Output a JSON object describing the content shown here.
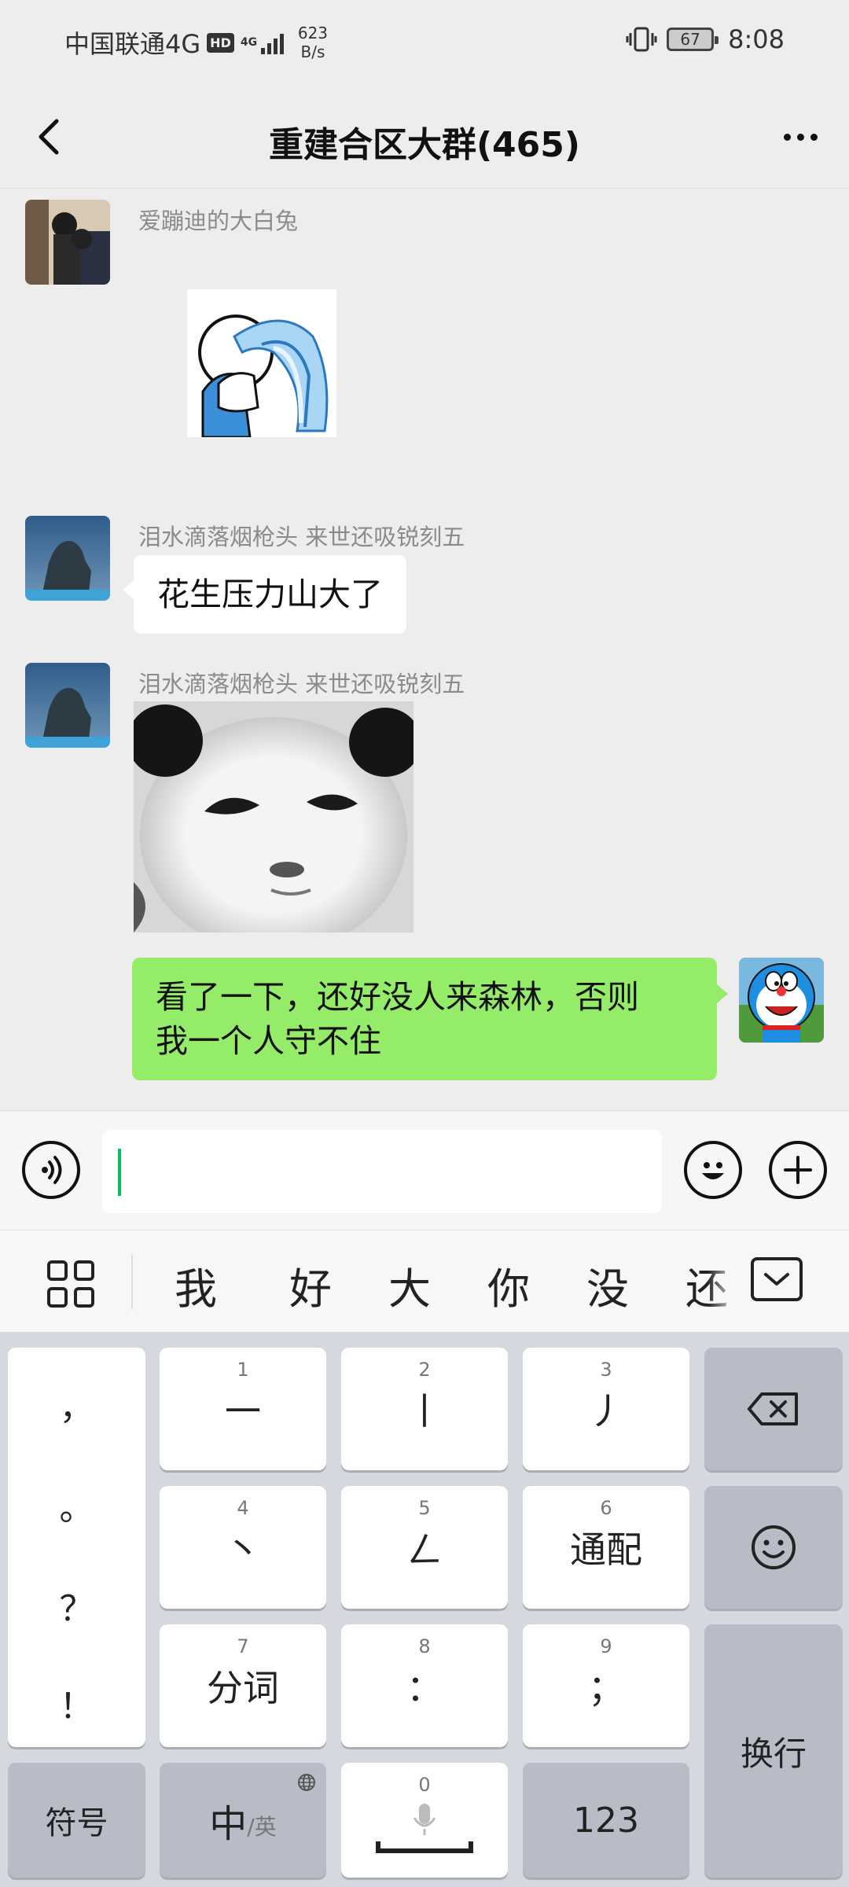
{
  "status_bar": {
    "carrier": "中国联通4G",
    "hd": "HD",
    "network_type": "4G",
    "speed_value": "623",
    "speed_unit": "B/s",
    "battery": "67",
    "time": "8:08"
  },
  "header": {
    "title": "重建合区大群(465)"
  },
  "messages": [
    {
      "sender": "爱蹦迪的大白兔",
      "type": "sticker"
    },
    {
      "sender": "泪水滴落烟枪头 来世还吸锐刻五",
      "type": "text",
      "text": "花生压力山大了"
    },
    {
      "sender": "泪水滴落烟枪头 来世还吸锐刻五",
      "type": "sticker"
    },
    {
      "sender": "me",
      "type": "text",
      "line1": "看了一下，还好没人来森林，否则",
      "line2": "我一个人守不住"
    }
  ],
  "input_bar": {
    "value": ""
  },
  "candidates": {
    "words": [
      "我",
      "好",
      "大",
      "你",
      "没",
      "还"
    ]
  },
  "keyboard": {
    "punct": [
      "，",
      "。",
      "？",
      "！"
    ],
    "keys": [
      {
        "num": "1",
        "label": "一"
      },
      {
        "num": "2",
        "label": "丨"
      },
      {
        "num": "3",
        "label": "丿"
      },
      {
        "num": "4",
        "label": "丶"
      },
      {
        "num": "5",
        "label": "ㄥ"
      },
      {
        "num": "6",
        "label": "通配"
      },
      {
        "num": "7",
        "label": "分词"
      },
      {
        "num": "8",
        "label": "："
      },
      {
        "num": "9",
        "label": "；"
      },
      {
        "num": "0",
        "label": ""
      }
    ],
    "enter": "换行",
    "symbols": "符号",
    "lang_main": "中",
    "lang_sub": "/英",
    "numbers": "123"
  },
  "colors": {
    "background": "#ededed",
    "my_bubble": "#95ec69",
    "cursor": "#07c160"
  }
}
